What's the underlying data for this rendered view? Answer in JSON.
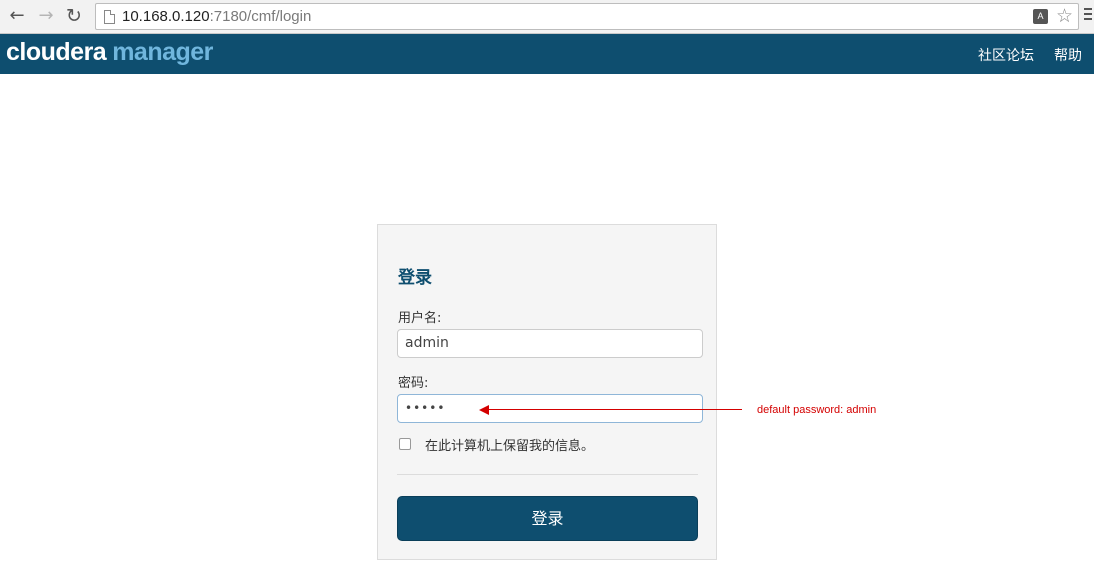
{
  "browser": {
    "url_host": "10.168.0.120",
    "url_rest": ":7180/cmf/login",
    "icons": {
      "back": "arrow-left-icon",
      "forward": "arrow-right-icon",
      "reload": "reload-icon",
      "page": "page-icon",
      "translate": "translate-icon",
      "bookmark": "star-icon",
      "menu": "hamburger-menu-icon"
    },
    "translate_glyph": "A"
  },
  "header": {
    "logo_part1": "cloudera",
    "logo_part2": "manager",
    "links": [
      "社区论坛",
      "帮助"
    ],
    "bg_color": "#0e4e6f",
    "accent_color": "#70b6dd"
  },
  "login": {
    "title": "登录",
    "username_label": "用户名:",
    "username_value": "admin",
    "password_label": "密码:",
    "password_value": "•••••",
    "remember_label": "在此计算机上保留我的信息。",
    "remember_checked": false,
    "submit_label": "登录"
  },
  "annotation": {
    "text": "default password: admin",
    "color": "#d40000"
  }
}
